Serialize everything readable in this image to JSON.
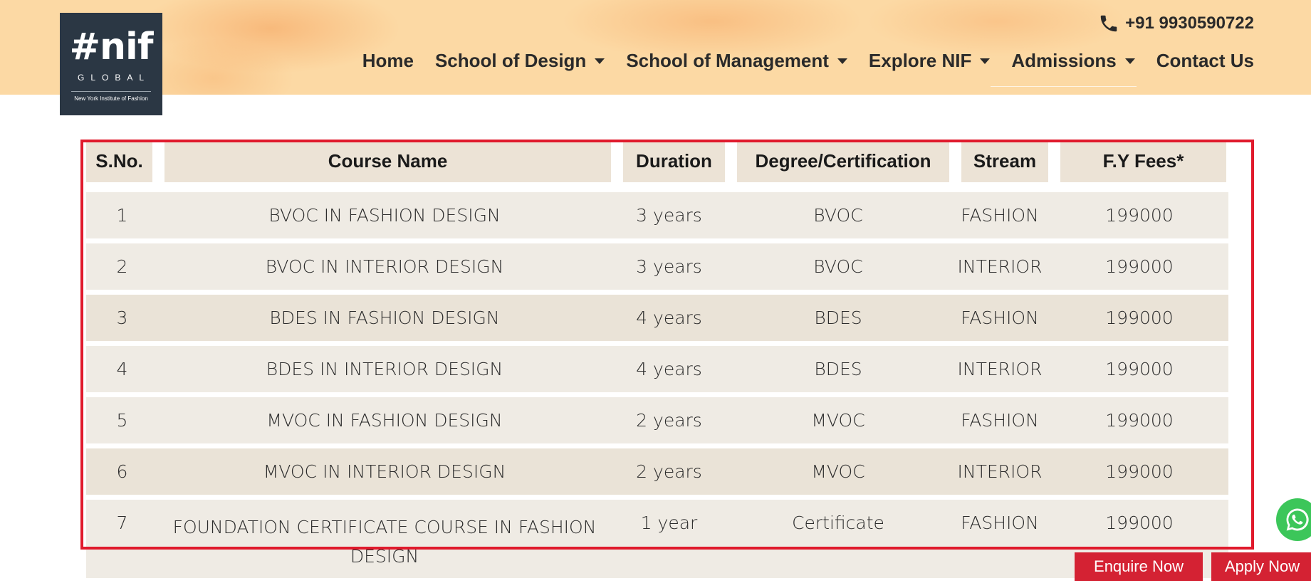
{
  "header": {
    "logo": {
      "main": "#nif",
      "sub": "GLOBAL",
      "tagline": "New York Institute of Fashion"
    },
    "phone": "+91 9930590722",
    "phone_icon": "phone-icon",
    "nav": [
      {
        "label": "Home",
        "dropdown": false
      },
      {
        "label": "School of Design",
        "dropdown": true
      },
      {
        "label": "School of Management",
        "dropdown": true
      },
      {
        "label": "Explore NIF",
        "dropdown": true
      },
      {
        "label": "Admissions",
        "dropdown": true
      },
      {
        "label": "Contact Us",
        "dropdown": false
      }
    ]
  },
  "table": {
    "headers": [
      "S.No.",
      "Course Name",
      "Duration",
      "Degree/Certification",
      "Stream",
      "F.Y Fees*"
    ],
    "rows": [
      [
        "1",
        "BVOC IN FASHION DESIGN",
        "3 years",
        "BVOC",
        "FASHION",
        "199000"
      ],
      [
        "2",
        "BVOC IN INTERIOR DESIGN",
        "3 years",
        "BVOC",
        "INTERIOR",
        "199000"
      ],
      [
        "3",
        "BDES IN FASHION DESIGN",
        "4 years",
        "BDES",
        "FASHION",
        "199000"
      ],
      [
        "4",
        "BDES IN INTERIOR DESIGN",
        "4 years",
        "BDES",
        "INTERIOR",
        "199000"
      ],
      [
        "5",
        "MVOC IN FASHION DESIGN",
        "2 years",
        "MVOC",
        "FASHION",
        "199000"
      ],
      [
        "6",
        "MVOC IN INTERIOR DESIGN",
        "2 years",
        "MVOC",
        "INTERIOR",
        "199000"
      ],
      [
        "7",
        "FOUNDATION CERTIFICATE COURSE IN FASHION DESIGN",
        "1 year",
        "Certificate",
        "FASHION",
        "199000"
      ]
    ]
  },
  "floating": {
    "enquire_label": "Enquire Now",
    "apply_label": "Apply Now",
    "whatsapp_icon": "whatsapp-icon"
  },
  "colors": {
    "header_bg": "#fcd9a4",
    "accent_red": "#d42233",
    "highlight_border": "#e01a2c",
    "table_head_bg": "#ece3d6",
    "table_row_bg": "#efebe4"
  }
}
